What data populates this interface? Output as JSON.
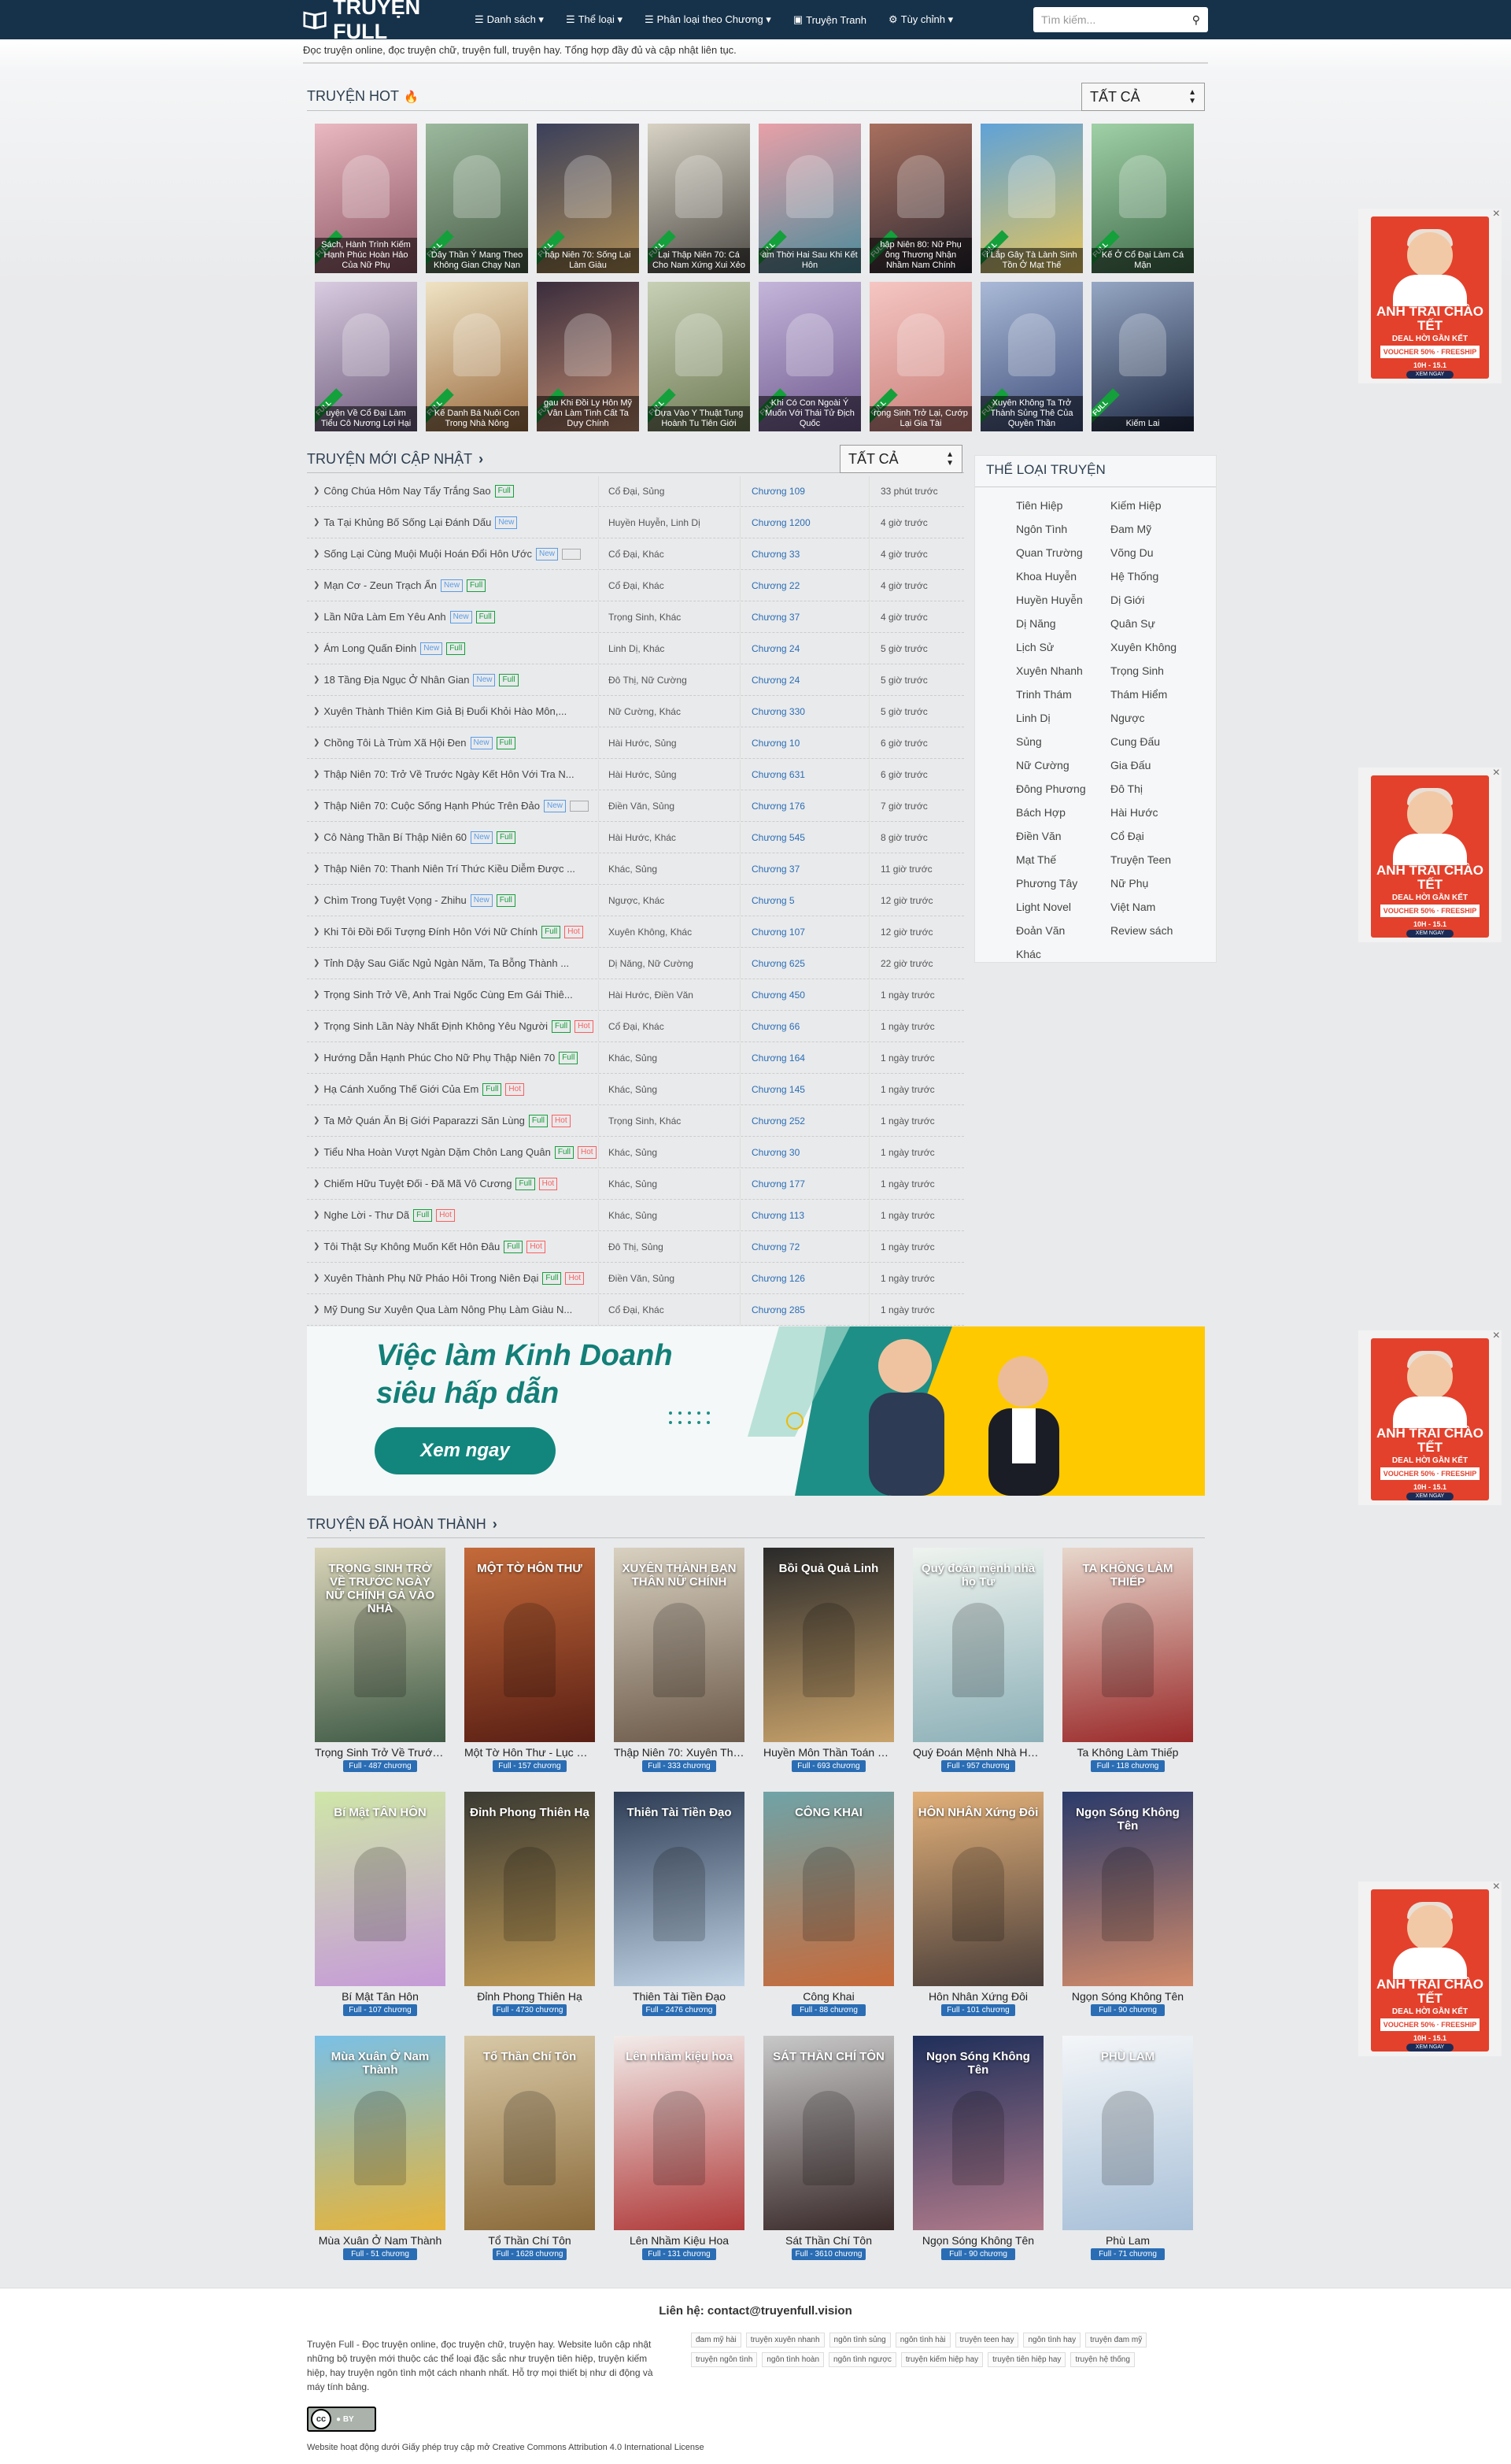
{
  "nav": {
    "brand": "TRUYỆN FULL",
    "items": [
      {
        "icon": "☰",
        "label": "Danh sách ▾"
      },
      {
        "icon": "☰",
        "label": "Thể loại ▾"
      },
      {
        "icon": "☰",
        "label": "Phân loại theo Chương ▾"
      },
      {
        "icon": "▣",
        "label": "Truyện Tranh"
      },
      {
        "icon": "⚙",
        "label": "Tùy chỉnh ▾"
      }
    ],
    "search_placeholder": "Tìm kiếm..."
  },
  "intro": "Đọc truyện online, đọc truyện chữ, truyện full, truyện hay. Tổng hợp đầy đủ và cập nhật liên tục.",
  "hot": {
    "title": "TRUYỆN HOT",
    "filter": "TẤT CẢ",
    "full_badge": "FULL",
    "items": [
      {
        "caption": "Sách, Hành Trình Kiếm Hạnh Phúc Hoàn Hảo Của Nữ Phụ",
        "c1": "#e9b8c0",
        "c2": "#8b5563"
      },
      {
        "caption": "Dây Thần Ý Mang Theo Không Gian Chạy Nạn",
        "c1": "#9bb89d",
        "c2": "#4a5e47"
      },
      {
        "caption": "hập Niên 70: Sống Lại Làm Giàu",
        "c1": "#3a3f5a",
        "c2": "#b08e55"
      },
      {
        "caption": "Lại Thập Niên 70: Cá Cho Nam Xứng Xui Xẻo",
        "c1": "#d7d2c4",
        "c2": "#4d4a45"
      },
      {
        "caption": "am Thời Hai Sau Khi Kết Hôn",
        "c1": "#e8a0a8",
        "c2": "#4a8a9a"
      },
      {
        "caption": "hập Niên 80: Nữ Phụ ông Thương Nhận Nhầm Nam Chính",
        "c1": "#a86f5e",
        "c2": "#2e2a33"
      },
      {
        "caption": "i Lắp Gây Tà Lành Sinh Tồn Ở Mạt Thế",
        "c1": "#5fa2d8",
        "c2": "#e6c45a"
      },
      {
        "caption": "Kế Ở Cổ Đại Làm Cá Mặn",
        "c1": "#9fd0a6",
        "c2": "#406b4a"
      },
      {
        "caption": "uyện Về Cổ Đại Làm Tiểu Cô Nương Lợi Hại",
        "c1": "#d9cbe0",
        "c2": "#6b5a7a"
      },
      {
        "caption": "Kế Danh Bá Nuôi Con Trong Nhà Nông",
        "c1": "#efe3c4",
        "c2": "#9a6b3f"
      },
      {
        "caption": "gau Khi Đồi Ly Hôn Mỹ Vân Làm Tình Cất Ta Dựy Chính",
        "c1": "#3a2d3d",
        "c2": "#c08a6e"
      },
      {
        "caption": "Dựa Vào Y Thuật Tung Hoành Tu Tiên Giới",
        "c1": "#c7cfb5",
        "c2": "#6e7a54"
      },
      {
        "caption": "Khi Có Con Ngoài Ý Muốn Với Thái Tử Địch Quốc",
        "c1": "#c4b5da",
        "c2": "#6f5a8f"
      },
      {
        "caption": "rọng Sinh Trở Lại, Cướp Lại Gia Tài",
        "c1": "#f5c6c3",
        "c2": "#c87e78"
      },
      {
        "caption": "Xuyên Không Ta Trở Thành Sủng Thê Của Quyền Thần",
        "c1": "#a9b9d6",
        "c2": "#3e4e7a"
      },
      {
        "caption": "Kiếm Lai",
        "c1": "#95a7c4",
        "c2": "#1f2a44"
      }
    ]
  },
  "updated": {
    "title": "TRUYỆN MỚI CẬP NHẬT",
    "filter": "TẤT CẢ",
    "rows": [
      {
        "title": "Công Chúa Hôm Nay Tẩy Trắng Sao",
        "labels": [
          "full"
        ],
        "genre": "Cổ Đại, Sủng",
        "chapter": "Chương 109",
        "time": "33 phút trước"
      },
      {
        "title": "Ta Tại Khủng Bố Sống Lại Đánh Dấu",
        "labels": [
          "new"
        ],
        "genre": "Huyền Huyễn, Linh Dị",
        "chapter": "Chương 1200",
        "time": "4 giờ trước"
      },
      {
        "title": "Sống Lại Cùng Muội Muội Hoán Đổi Hôn Ước",
        "labels": [
          "new",
          "blank"
        ],
        "genre": "Cổ Đại, Khác",
        "chapter": "Chương 33",
        "time": "4 giờ trước"
      },
      {
        "title": "Mạn Cơ - Zeun Trạch Ẩn",
        "labels": [
          "new",
          "full"
        ],
        "genre": "Cổ Đại, Khác",
        "chapter": "Chương 22",
        "time": "4 giờ trước"
      },
      {
        "title": "Lần Nữa Làm Em Yêu Anh",
        "labels": [
          "new",
          "full"
        ],
        "genre": "Trọng Sinh, Khác",
        "chapter": "Chương 37",
        "time": "4 giờ trước"
      },
      {
        "title": "Ám Long Quấn Đinh",
        "labels": [
          "new",
          "full"
        ],
        "genre": "Linh Dị, Khác",
        "chapter": "Chương 24",
        "time": "5 giờ trước"
      },
      {
        "title": "18 Tầng Địa Ngục Ở Nhân Gian",
        "labels": [
          "new",
          "full"
        ],
        "genre": "Đô Thị, Nữ Cường",
        "chapter": "Chương 24",
        "time": "5 giờ trước"
      },
      {
        "title": "Xuyên Thành Thiên Kim Giả Bị Đuổi Khỏi Hào Môn,...",
        "labels": [],
        "genre": "Nữ Cường, Khác",
        "chapter": "Chương 330",
        "time": "5 giờ trước"
      },
      {
        "title": "Chồng Tôi Là Trùm Xã Hội Đen",
        "labels": [
          "new",
          "full"
        ],
        "genre": "Hài Hước, Sủng",
        "chapter": "Chương 10",
        "time": "6 giờ trước"
      },
      {
        "title": "Thập Niên 70: Trở Về Trước Ngày Kết Hôn Với Tra N...",
        "labels": [],
        "genre": "Hài Hước, Sủng",
        "chapter": "Chương 631",
        "time": "6 giờ trước"
      },
      {
        "title": "Thập Niên 70: Cuộc Sống Hạnh Phúc Trên Đảo",
        "labels": [
          "new",
          "blank"
        ],
        "genre": "Điền Văn, Sủng",
        "chapter": "Chương 176",
        "time": "7 giờ trước"
      },
      {
        "title": "Cô Nàng Thần Bí Thập Niên 60",
        "labels": [
          "new",
          "full"
        ],
        "genre": "Hài Hước, Khác",
        "chapter": "Chương 545",
        "time": "8 giờ trước"
      },
      {
        "title": "Thập Niên 70: Thanh Niên Trí Thức Kiều Diễm Được ...",
        "labels": [],
        "genre": "Khác, Sủng",
        "chapter": "Chương 37",
        "time": "11 giờ trước"
      },
      {
        "title": "Chìm Trong Tuyệt Vọng - Zhihu",
        "labels": [
          "new",
          "full"
        ],
        "genre": "Ngược, Khác",
        "chapter": "Chương 5",
        "time": "12 giờ trước"
      },
      {
        "title": "Khi Tôi Đồi Đối Tượng Đính Hôn Với Nữ Chính",
        "labels": [
          "full",
          "hot"
        ],
        "genre": "Xuyên Không, Khác",
        "chapter": "Chương 107",
        "time": "12 giờ trước"
      },
      {
        "title": "Tỉnh Dậy Sau Giấc Ngủ Ngàn Năm, Ta Bỗng Thành ...",
        "labels": [],
        "genre": "Dị Năng, Nữ Cường",
        "chapter": "Chương 625",
        "time": "22 giờ trước"
      },
      {
        "title": "Trọng Sinh Trở Về, Anh Trai Ngốc Cùng Em Gái Thiê...",
        "labels": [],
        "genre": "Hài Hước, Điền Văn",
        "chapter": "Chương 450",
        "time": "1 ngày trước"
      },
      {
        "title": "Trọng Sinh Lần Này Nhất Định Không Yêu Người",
        "labels": [
          "full",
          "hot"
        ],
        "genre": "Cổ Đại, Khác",
        "chapter": "Chương 66",
        "time": "1 ngày trước"
      },
      {
        "title": "Hướng Dẫn Hạnh Phúc Cho Nữ Phụ Thập Niên 70",
        "labels": [
          "full"
        ],
        "genre": "Khác, Sủng",
        "chapter": "Chương 164",
        "time": "1 ngày trước"
      },
      {
        "title": "Hạ Cánh Xuống Thế Giới Của Em",
        "labels": [
          "full",
          "hot"
        ],
        "genre": "Khác, Sủng",
        "chapter": "Chương 145",
        "time": "1 ngày trước"
      },
      {
        "title": "Ta Mở Quán Ăn Bị Giới Paparazzi Săn Lùng",
        "labels": [
          "full",
          "hot"
        ],
        "genre": "Trọng Sinh, Khác",
        "chapter": "Chương 252",
        "time": "1 ngày trước"
      },
      {
        "title": "Tiểu Nha Hoàn Vượt Ngàn Dặm Chôn Lang Quân",
        "labels": [
          "full",
          "hot"
        ],
        "genre": "Khác, Sủng",
        "chapter": "Chương 30",
        "time": "1 ngày trước"
      },
      {
        "title": "Chiếm Hữu Tuyệt Đối - Đã Mã Vô Cương",
        "labels": [
          "full",
          "hot"
        ],
        "genre": "Khác, Sủng",
        "chapter": "Chương 177",
        "time": "1 ngày trước"
      },
      {
        "title": "Nghe Lời - Thư Dã",
        "labels": [
          "full",
          "hot"
        ],
        "genre": "Khác, Sủng",
        "chapter": "Chương 113",
        "time": "1 ngày trước"
      },
      {
        "title": "Tôi Thật Sự Không Muốn Kết Hôn Đâu",
        "labels": [
          "full",
          "hot"
        ],
        "genre": "Đô Thị, Sủng",
        "chapter": "Chương 72",
        "time": "1 ngày trước"
      },
      {
        "title": "Xuyên Thành Phụ Nữ Pháo Hôi Trong Niên Đại",
        "labels": [
          "full",
          "hot"
        ],
        "genre": "Điền Văn, Sủng",
        "chapter": "Chương 126",
        "time": "1 ngày trước"
      },
      {
        "title": "Mỹ Dung Sư Xuyên Qua Làm Nông Phụ Làm Giàu N...",
        "labels": [],
        "genre": "Cổ Đại, Khác",
        "chapter": "Chương 285",
        "time": "1 ngày trước"
      }
    ],
    "label_text": {
      "new": "New",
      "full": "Full",
      "hot": "Hot",
      "blank": ""
    }
  },
  "genres": {
    "title": "THỂ LOẠI TRUYỆN",
    "items": [
      "Tiên Hiệp",
      "Kiếm Hiệp",
      "Ngôn Tình",
      "Đam Mỹ",
      "Quan Trường",
      "Võng Du",
      "Khoa Huyễn",
      "Hệ Thống",
      "Huyền Huyễn",
      "Dị Giới",
      "Dị Năng",
      "Quân Sự",
      "Lịch Sử",
      "Xuyên Không",
      "Xuyên Nhanh",
      "Trọng Sinh",
      "Trinh Thám",
      "Thám Hiểm",
      "Linh Dị",
      "Ngược",
      "Sủng",
      "Cung Đấu",
      "Nữ Cường",
      "Gia Đấu",
      "Đông Phương",
      "Đô Thị",
      "Bách Hợp",
      "Hài Hước",
      "Điền Văn",
      "Cổ Đại",
      "Mạt Thế",
      "Truyện Teen",
      "Phương Tây",
      "Nữ Phụ",
      "Light Novel",
      "Việt Nam",
      "Đoản Văn",
      "Review sách",
      "Khác"
    ]
  },
  "banner": {
    "line1": "Việc làm Kinh Doanh",
    "line2": "siêu hấp dẫn",
    "button": "Xem ngay"
  },
  "completed": {
    "title": "TRUYỆN ĐÃ HOÀN THÀNH",
    "items": [
      {
        "name": "Trọng Sinh Trở Về Trước N...",
        "badge": "Full - 487 chương",
        "cover": "TRỌNG SINH TRỞ VỀ TRƯỚC NGÀY NỮ CHÍNH GẢ VÀO NHÀ",
        "c1": "#d9d4b8",
        "c2": "#3f5a45"
      },
      {
        "name": "Một Tờ Hôn Thư - Lục Dược",
        "badge": "Full - 157 chương",
        "cover": "MỘT TỜ HÔN THƯ",
        "c1": "#c46a3a",
        "c2": "#5a1f14"
      },
      {
        "name": "Thập Niên 70: Xuyên Thàn...",
        "badge": "Full - 333 chương",
        "cover": "XUYÊN THÀNH BẠN THÂN NỮ CHÍNH",
        "c1": "#d8d0c0",
        "c2": "#6c5a4a"
      },
      {
        "name": "Huyền Môn Thần Toán Bồi...",
        "badge": "Full - 693 chương",
        "cover": "Bồi Quả Quả Linh",
        "c1": "#2a2a2a",
        "c2": "#c9a36b"
      },
      {
        "name": "Quý Đoán Mệnh Nhà Họ T...",
        "badge": "Full - 957 chương",
        "cover": "Quý đoán mệnh nhà họ Tư",
        "c1": "#eef3ee",
        "c2": "#8cb0b8"
      },
      {
        "name": "Ta Không Làm Thiếp",
        "badge": "Full - 118 chương",
        "cover": "TA KHÔNG LÀM THIẾP",
        "c1": "#e7d7cc",
        "c2": "#9a2a2a"
      },
      {
        "name": "Bí Mật Tân Hôn",
        "badge": "Full - 107 chương",
        "cover": "Bí Mật TÂN HÔN",
        "c1": "#cfe6a8",
        "c2": "#c69bd8"
      },
      {
        "name": "Đỉnh Phong Thiên Hạ",
        "badge": "Full - 4730 chương",
        "cover": "Đỉnh Phong Thiên Hạ",
        "c1": "#3a3a33",
        "c2": "#c09a55"
      },
      {
        "name": "Thiên Tài Tiền Đạo",
        "badge": "Full - 2476 chương",
        "cover": "Thiên Tài Tiền Đạo",
        "c1": "#2e3d55",
        "c2": "#c0d4e6"
      },
      {
        "name": "Công Khai",
        "badge": "Full - 88 chương",
        "cover": "CÔNG KHAI",
        "c1": "#6fa3a8",
        "c2": "#c76a3a"
      },
      {
        "name": "Hôn Nhân Xứng Đôi",
        "badge": "Full - 101 chương",
        "cover": "HÔN NHÂN Xứng Đôi",
        "c1": "#e2b079",
        "c2": "#4a3e3a"
      },
      {
        "name": "Ngọn Sóng Không Tên",
        "badge": "Full - 90 chương",
        "cover": "Ngọn Sóng Không Tên",
        "c1": "#2a3a6a",
        "c2": "#d08a6a"
      },
      {
        "name": "Mùa Xuân Ở Nam Thành",
        "badge": "Full - 51 chương",
        "cover": "Mùa Xuân Ở Nam Thành",
        "c1": "#7ac0e6",
        "c2": "#e6b43a"
      },
      {
        "name": "Tổ Thần Chí Tôn",
        "badge": "Full - 1628 chương",
        "cover": "Tổ Thần Chí Tôn",
        "c1": "#d8c8a6",
        "c2": "#8a6a3a"
      },
      {
        "name": "Lên Nhầm Kiệu Hoa",
        "badge": "Full - 131 chương",
        "cover": "Lên nhầm kiệu hoa",
        "c1": "#f2ecea",
        "c2": "#b03a3a"
      },
      {
        "name": "Sát Thần Chí Tôn",
        "badge": "Full - 3610 chương",
        "cover": "SÁT THẦN CHÍ TÔN",
        "c1": "#c8c8c8",
        "c2": "#3a2a2a"
      },
      {
        "name": "Ngọn Sóng Không Tên",
        "badge": "Full - 90 chương",
        "cover": "Ngọn Sóng Không Tên",
        "c1": "#1f2f5a",
        "c2": "#b07a8a"
      },
      {
        "name": "Phù Lam",
        "badge": "Full - 71 chương",
        "cover": "PHÙ LAM",
        "c1": "#f4f6f8",
        "c2": "#a8c0d8"
      }
    ]
  },
  "ads": {
    "title": "ANH TRAI CHÀO TẾT",
    "sub": "DEAL HỜI GẦN KẾT",
    "promo": "VOUCHER 50% · FREESHIP",
    "date": "10H - 15.1",
    "cta": "XEM NGAY"
  },
  "footer": {
    "contact": "Liên hệ: contact@truyenfull.vision",
    "desc": "Truyện Full - Đọc truyện online, đọc truyện chữ, truyện hay. Website luôn cập nhật những bộ truyện mới thuộc các thể loại đặc sắc như truyện tiên hiệp, truyện kiếm hiệp, hay truyện ngôn tình một cách nhanh nhất. Hỗ trợ mọi thiết bị như di động và máy tính bảng.",
    "tags": [
      "đam mỹ hài",
      "truyện xuyên nhanh",
      "ngôn tình sủng",
      "ngôn tình hài",
      "truyện teen hay",
      "ngôn tình hay",
      "truyện đam mỹ",
      "truyện ngôn tình",
      "ngôn tình hoàn",
      "ngôn tình ngược",
      "truyện kiếm hiệp hay",
      "truyện tiên hiệp hay",
      "truyện hệ thống"
    ],
    "cc": "cc",
    "license": "Website hoạt động dưới Giấy phép truy cập mở Creative Commons Attribution 4.0 International License"
  }
}
